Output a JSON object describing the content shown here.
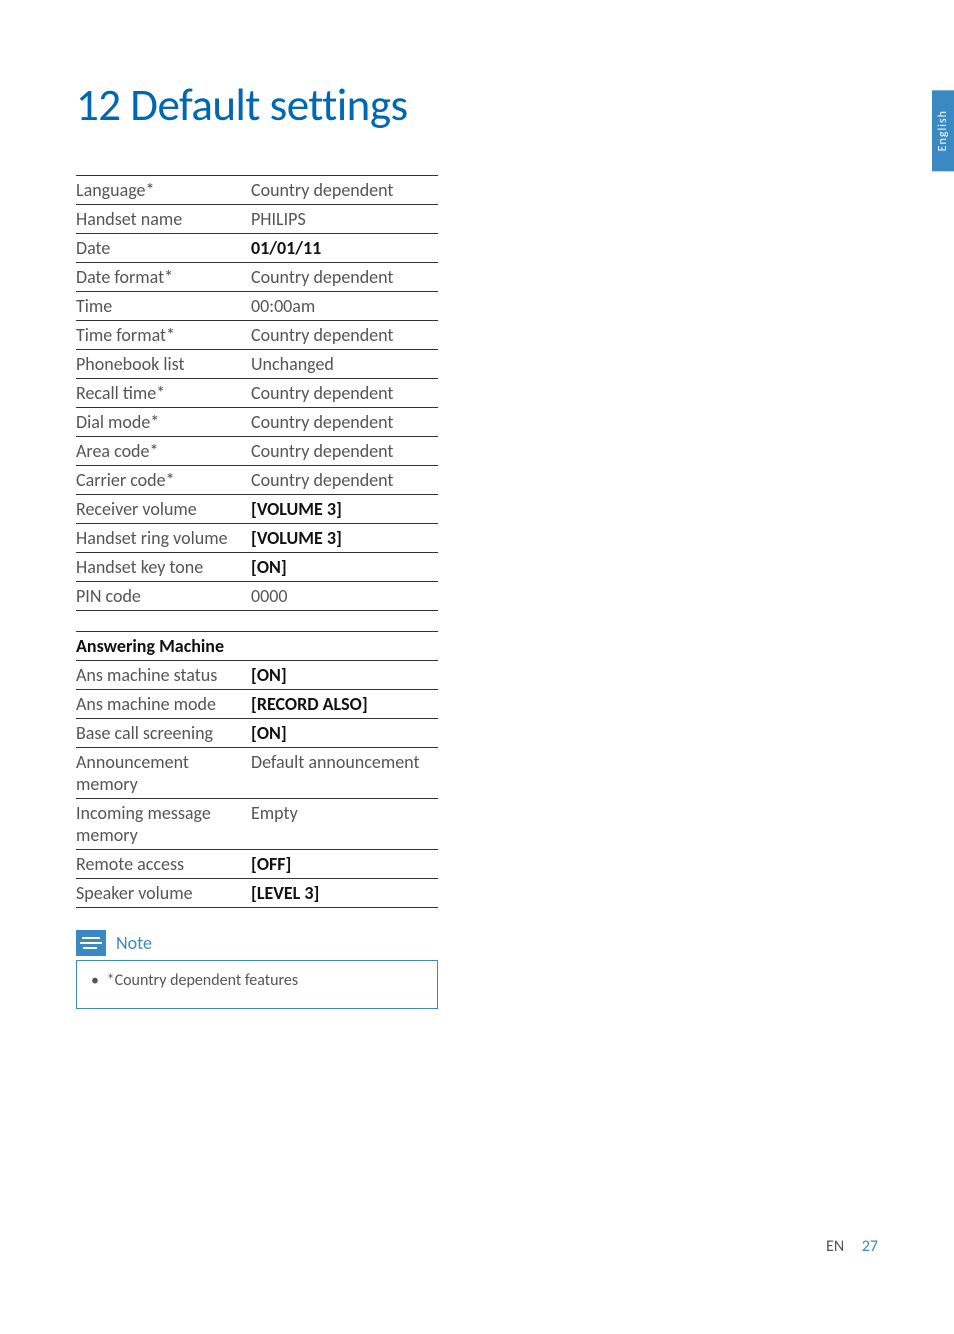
{
  "chapter_title": "12 Default settings",
  "side_tab": "English",
  "settings": {
    "rows": [
      {
        "label": "Language*",
        "value": "Country dependent",
        "bold": false
      },
      {
        "label": "Handset name",
        "value": "PHILIPS",
        "bold": false
      },
      {
        "label": "Date",
        "value": "01/01/11",
        "bold": true
      },
      {
        "label": "Date format*",
        "value": "Country dependent",
        "bold": false
      },
      {
        "label": "Time",
        "value": "00:00am",
        "bold": false
      },
      {
        "label": "Time format*",
        "value": "Country dependent",
        "bold": false
      },
      {
        "label": "Phonebook list",
        "value": "Unchanged",
        "bold": false
      },
      {
        "label": "Recall time*",
        "value": "Country dependent",
        "bold": false
      },
      {
        "label": "Dial mode*",
        "value": "Country dependent",
        "bold": false
      },
      {
        "label": "Area code*",
        "value": "Country dependent",
        "bold": false
      },
      {
        "label": "Carrier code*",
        "value": "Country dependent",
        "bold": false
      },
      {
        "label": "Receiver volume",
        "value": "[VOLUME 3]",
        "bold": true
      },
      {
        "label": "Handset ring volume",
        "value": "[VOLUME 3]",
        "bold": true
      },
      {
        "label": "Handset key tone",
        "value": "[ON]",
        "bold": true
      },
      {
        "label": "PIN code",
        "value": "0000",
        "bold": false
      }
    ]
  },
  "answering_section": {
    "header": "Answering Machine",
    "rows": [
      {
        "label": "Ans machine status",
        "value": "[ON]",
        "bold": true
      },
      {
        "label": "Ans machine mode",
        "value": "[RECORD ALSO]",
        "bold": true
      },
      {
        "label": "Base call screening",
        "value": "[ON]",
        "bold": true
      },
      {
        "label": "Announcement memory",
        "value": "Default announcement",
        "bold": false
      },
      {
        "label": "Incoming message memory",
        "value": "Empty",
        "bold": false
      },
      {
        "label": "Remote access",
        "value": "[OFF]",
        "bold": true
      },
      {
        "label": "Speaker volume",
        "value": "[LEVEL 3]",
        "bold": true
      }
    ]
  },
  "note": {
    "label": "Note",
    "text": "*Country dependent features"
  },
  "footer": {
    "lang": "EN",
    "page": "27"
  }
}
